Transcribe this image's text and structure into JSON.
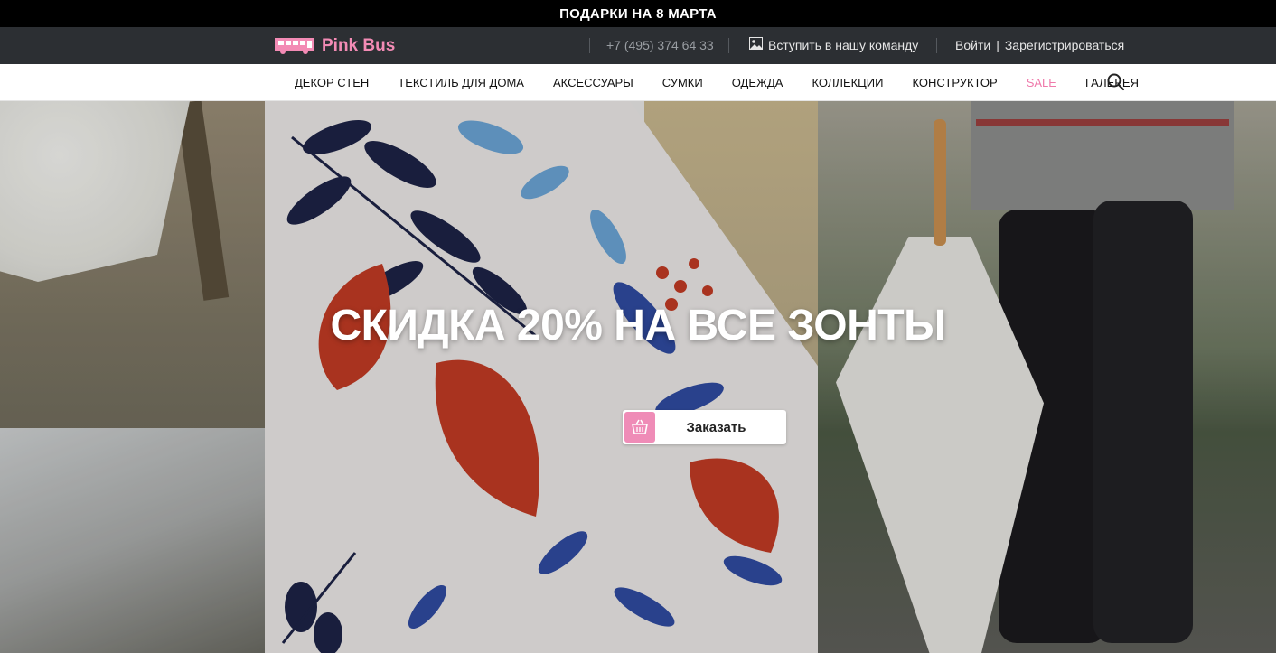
{
  "promo": {
    "text": "ПОДАРКИ НА 8 МАРТА"
  },
  "header": {
    "logo_text": "Pink Bus",
    "phone": "+7 (495) 374 64 33",
    "join_label": "Вступить в нашу команду",
    "login_label": "Войти",
    "divider": "|",
    "register_label": "Зарегистрироваться"
  },
  "nav": {
    "items": [
      {
        "label": "ДЕКОР СТЕН"
      },
      {
        "label": "ТЕКСТИЛЬ ДЛЯ ДОМА"
      },
      {
        "label": "АКСЕССУАРЫ"
      },
      {
        "label": "СУМКИ"
      },
      {
        "label": "ОДЕЖДА"
      },
      {
        "label": "КОЛЛЕКЦИИ"
      },
      {
        "label": "КОНСТРУКТОР"
      },
      {
        "label": "SALE"
      },
      {
        "label": "ГАЛЕРЕЯ"
      }
    ],
    "search_icon": "search-icon"
  },
  "hero": {
    "title": "СКИДКА 20% НА ВСЕ ЗОНТЫ",
    "button_label": "Заказать",
    "button_icon": "basket-icon"
  },
  "colors": {
    "brand_pink": "#f38bb5",
    "sale": "#ef7aab",
    "topbar": "#2c2f33",
    "promo_bar": "#000000"
  }
}
